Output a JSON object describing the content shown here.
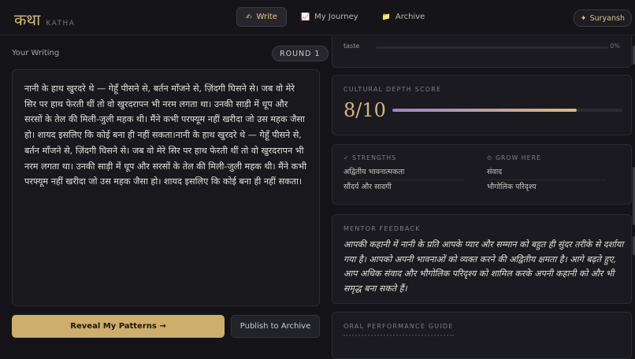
{
  "brand": {
    "name_hi": "कथा",
    "name_en": "KATHA"
  },
  "nav": {
    "tabs": [
      {
        "label": "Write",
        "icon": "writing-hand-icon",
        "active": true
      },
      {
        "label": "My Journey",
        "icon": "chart-icon",
        "active": false
      },
      {
        "label": "Archive",
        "icon": "folder-icon",
        "active": false
      }
    ]
  },
  "user": {
    "label": "Suryansh",
    "icon": "sparkle-icon"
  },
  "writing": {
    "title": "Your Writing",
    "round": "ROUND 1",
    "text": "नानी के हाथ खुरदरे थे — गेहूँ पीसने से, बर्तन माँजने से, ज़िंदगी घिसने से। जब वो मेरे सिर पर हाथ फेरती थीं तो वो खुरदरापन भी नरम लगता था। उनकी साड़ी में धूप और सरसों के तेल की मिली-जुली महक थी। मैंने कभी परफ्यूम नहीं खरीदा जो उस महक जैसा हो। शायद इसलिए कि कोई बना ही नहीं सकता।नानी के हाथ खुरदरे थे — गेहूँ पीसने से, बर्तन माँजने से, ज़िंदगी घिसने से। जब वो मेरे सिर पर हाथ फेरती थीं तो वो खुरदरापन भी नरम लगता था। उनकी साड़ी में धूप और सरसों के तेल की मिली-जुली महक थी। मैंने कभी परफ्यूम नहीं खरीदा जो उस महक जैसा हो। शायद इसलिए कि कोई बना ही नहीं सकता।",
    "reveal_button": "Reveal My Patterns →",
    "publish_button": "Publish to Archive"
  },
  "taste": {
    "label": "taste",
    "value": "0%"
  },
  "score": {
    "title": "CULTURAL DEPTH SCORE",
    "value": "8/10",
    "fraction": 0.8,
    "colors": {
      "bar_start": "#9b84c9",
      "bar_end": "#d8b87a"
    }
  },
  "strengths": {
    "title": "✓ STRENGTHS",
    "items": [
      "अद्वितीय भावनात्मकता",
      "सौंदर्य और सादगी"
    ]
  },
  "grow": {
    "title": "⊙ GROW HERE",
    "items": [
      "संवाद",
      "भौगोलिक परिदृश्य"
    ]
  },
  "mentor": {
    "title": "MENTOR FEEDBACK",
    "text": "आपकी कहानी में नानी के प्रति आपके प्यार और सम्मान को बहुत ही सुंदर तरीके से दर्शाया गया है। आपको अपनी भावनाओं को व्यक्त करने की अद्वितीय क्षमता है। आगे बढ़ते हुए, आप अधिक संवाद और भौगोलिक परिदृश्य को शामिल करके अपनी कहानी को और भी समृद्ध बना सकते हैं।"
  },
  "oral": {
    "title": "ORAL PERFORMANCE GUIDE"
  },
  "colors": {
    "accent": "#d8b87a",
    "background": "#141418",
    "card": "#1a1a20"
  }
}
